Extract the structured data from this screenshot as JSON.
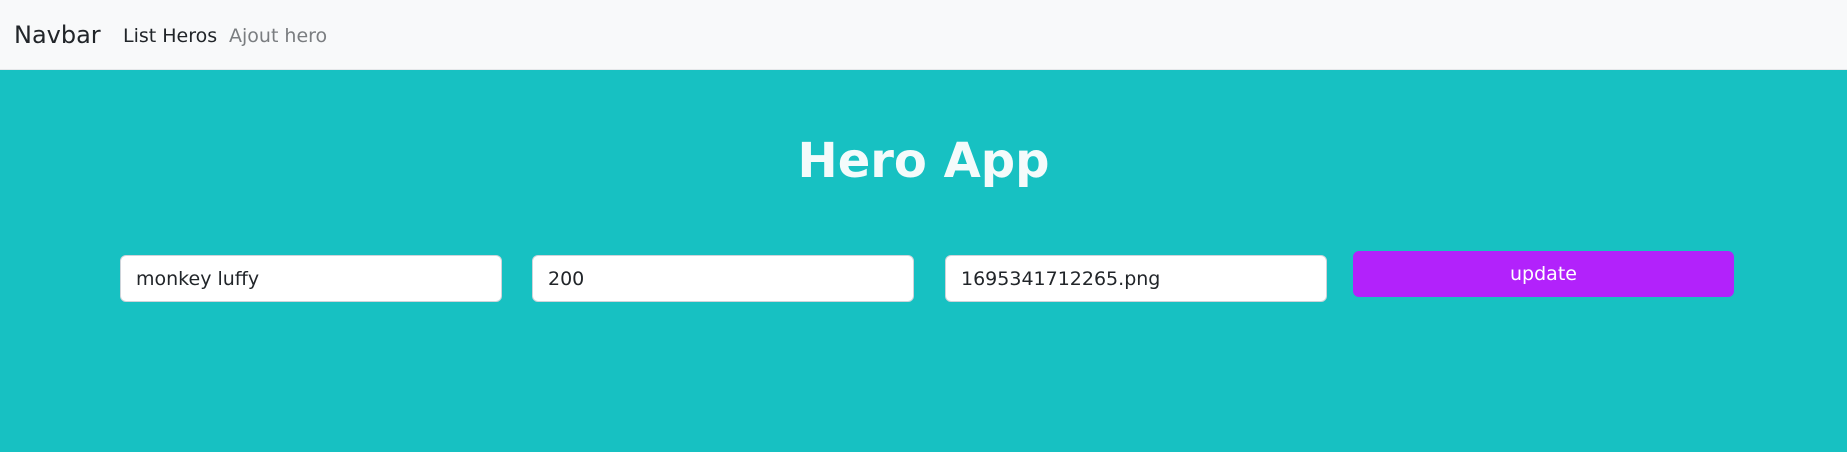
{
  "navbar": {
    "brand": "Navbar",
    "links": [
      {
        "label": "List Heros",
        "active": true
      },
      {
        "label": "Ajout hero",
        "active": false
      }
    ]
  },
  "main": {
    "title": "Hero App",
    "form": {
      "name_value": "monkey luffy",
      "power_value": "200",
      "image_value": "1695341712265.png",
      "submit_label": "update"
    }
  },
  "colors": {
    "background": "#17c1c2",
    "navbar_bg": "#f8f9fa",
    "button": "#b222fb"
  }
}
